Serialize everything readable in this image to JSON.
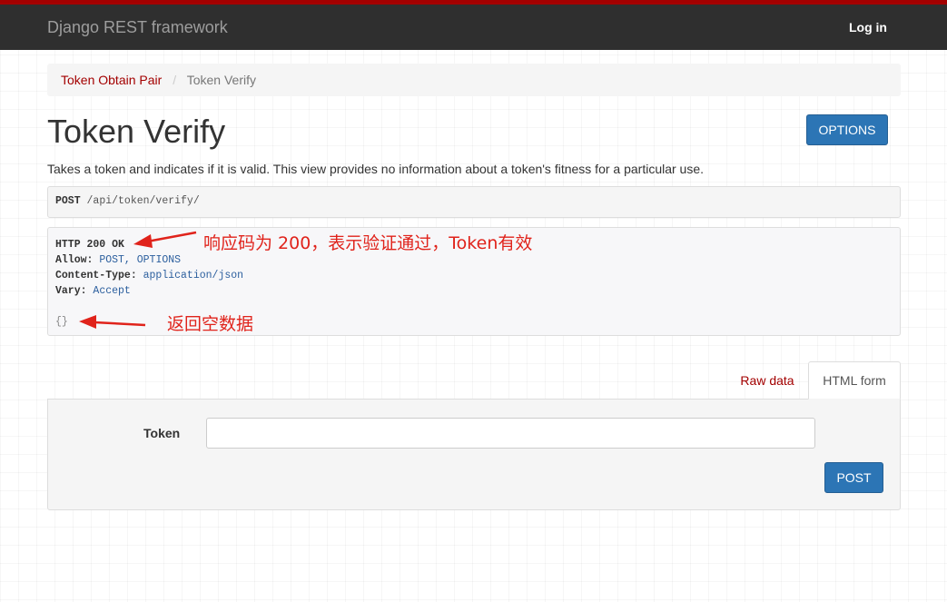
{
  "navbar": {
    "brand": "Django REST framework",
    "login": "Log in"
  },
  "breadcrumb": {
    "items": [
      {
        "label": "Token Obtain Pair"
      },
      {
        "label": "Token Verify"
      }
    ],
    "separator": "/"
  },
  "header": {
    "title": "Token Verify",
    "options_label": "OPTIONS",
    "description": "Takes a token and indicates if it is valid. This view provides no information about a token's fitness for a particular use."
  },
  "request": {
    "method": "POST",
    "path": "/api/token/verify/"
  },
  "response": {
    "status": "HTTP 200 OK",
    "allow_key": "Allow:",
    "allow_value": "POST, OPTIONS",
    "content_type_key": "Content-Type:",
    "content_type_value": "application/json",
    "vary_key": "Vary:",
    "vary_value": "Accept",
    "body": "{}"
  },
  "annotations": {
    "status_note": "响应码为 200，表示验证通过，Token有效",
    "body_note": "返回空数据",
    "color": "#e0231b"
  },
  "tabs": {
    "raw": "Raw data",
    "html": "HTML form"
  },
  "form": {
    "token_label": "Token",
    "token_value": "",
    "submit_label": "POST"
  },
  "colors": {
    "brand_red": "#a30000",
    "navbar_bg": "#2f2f2f",
    "button_blue": "#2c75b5"
  }
}
